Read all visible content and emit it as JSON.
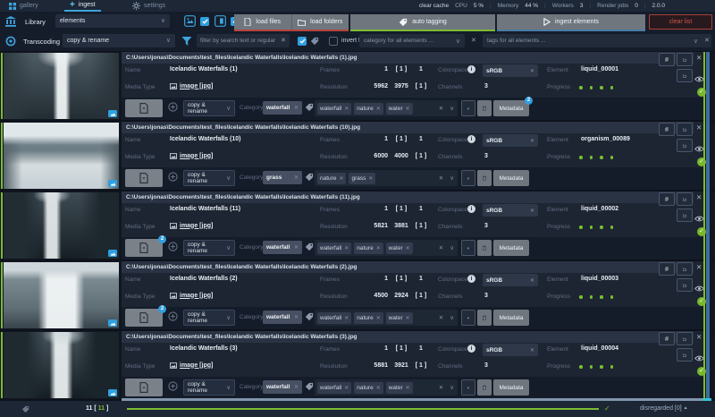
{
  "titlebar": {
    "tabs": [
      {
        "label": "gallery"
      },
      {
        "label": "ingest"
      },
      {
        "label": "settings"
      }
    ],
    "stats": {
      "clear_cache": "clear cache",
      "cpu_label": "CPU",
      "cpu_value": "5 %",
      "memory_label": "Memory",
      "memory_value": "44 %",
      "workers_label": "Workers",
      "workers_value": "3",
      "render_label": "Render jobs",
      "render_value": "0",
      "version": "2.0.0"
    }
  },
  "toolbar": {
    "library_label": "Library",
    "library_value": "elements",
    "load_files": "load files",
    "load_folders": "load folders",
    "auto_tagging": "auto tagging",
    "ingest_elements": "ingest elements",
    "clear_list": "clear list"
  },
  "filterbar": {
    "transcoding_label": "Transcoding",
    "transcoding_value": "copy & rename",
    "search_placeholder": "filter by search text or regular expres",
    "invert_filter_label": "invert filter",
    "category_placeholder": "category for all elements ...",
    "tags_placeholder": "tags for all elements ..."
  },
  "labels": {
    "name": "Name",
    "media_type": "Media Type",
    "frames": "Frames",
    "resolution": "Resolution",
    "colorspace": "Colorspace",
    "channels": "Channels",
    "element": "Element",
    "progress": "Progress",
    "category": "Category",
    "copy_rename": "copy & rename",
    "metadata": "Metadata",
    "info_glyph": "i"
  },
  "entries": [
    {
      "path": "C:\\Users\\jonas\\Documents\\test_files\\Icelandic Waterfalls\\Icelandic Waterfalls (1).jpg",
      "name": "Icelandic Waterfalls (1)",
      "frames": [
        "1",
        "[ 1 ]",
        "1"
      ],
      "colorspace": "sRGB",
      "element": "liquid_00001",
      "media": "image [jpg]",
      "res": [
        "5962",
        "3975",
        "[ 1 ]"
      ],
      "channels": "3",
      "category": "waterfall",
      "tags": [
        "waterfall",
        "nature",
        "water"
      ],
      "file_badge": null,
      "meta_badge": "2"
    },
    {
      "path": "C:\\Users\\jonas\\Documents\\test_files\\Icelandic Waterfalls\\Icelandic Waterfalls (10).jpg",
      "name": "Icelandic Waterfalls (10)",
      "frames": [
        "1",
        "[ 1 ]",
        "1"
      ],
      "colorspace": "sRGB",
      "element": "organism_00089",
      "media": "image [jpg]",
      "res": [
        "6000",
        "4000",
        "[ 1 ]"
      ],
      "channels": "3",
      "category": "grass",
      "tags": [
        "nature",
        "grass"
      ],
      "file_badge": null,
      "meta_badge": null
    },
    {
      "path": "C:\\Users\\jonas\\Documents\\test_files\\Icelandic Waterfalls\\Icelandic Waterfalls (11).jpg",
      "name": "Icelandic Waterfalls (11)",
      "frames": [
        "1",
        "[ 1 ]",
        "1"
      ],
      "colorspace": "sRGB",
      "element": "liquid_00002",
      "media": "image [jpg]",
      "res": [
        "5821",
        "3881",
        "[ 1 ]"
      ],
      "channels": "3",
      "category": "waterfall",
      "tags": [
        "waterfall",
        "nature",
        "water"
      ],
      "file_badge": "2",
      "meta_badge": null
    },
    {
      "path": "C:\\Users\\jonas\\Documents\\test_files\\Icelandic Waterfalls\\Icelandic Waterfalls (2).jpg",
      "name": "Icelandic Waterfalls (2)",
      "frames": [
        "1",
        "[ 1 ]",
        "1"
      ],
      "colorspace": "sRGB",
      "element": "liquid_00003",
      "media": "image [jpg]",
      "res": [
        "4500",
        "2924",
        "[ 1 ]"
      ],
      "channels": "3",
      "category": "waterfall",
      "tags": [
        "waterfall",
        "nature",
        "water"
      ],
      "file_badge": "2",
      "meta_badge": null
    },
    {
      "path": "C:\\Users\\jonas\\Documents\\test_files\\Icelandic Waterfalls\\Icelandic Waterfalls (3).jpg",
      "name": "Icelandic Waterfalls (3)",
      "frames": [
        "1",
        "[ 1 ]",
        "1"
      ],
      "colorspace": "sRGB",
      "element": "liquid_00004",
      "media": "image [jpg]",
      "res": [
        "5881",
        "3921",
        "[ 1 ]"
      ],
      "channels": "3",
      "category": "waterfall",
      "tags": [
        "waterfall",
        "nature",
        "water"
      ],
      "file_badge": null,
      "meta_badge": null
    }
  ],
  "statusbar": {
    "count": "11",
    "bracket_open": "[",
    "count_inner": "11",
    "bracket_close": "]",
    "disregarded": "disregarded [0]",
    "arrow": "▲"
  },
  "colors": {
    "accent_blue": "#3fa3dc",
    "accent_green": "#7dbb33",
    "accent_red": "#b5443b",
    "badge_blue": "#2f9fe0",
    "steel_blue": "#4b7ca3"
  }
}
